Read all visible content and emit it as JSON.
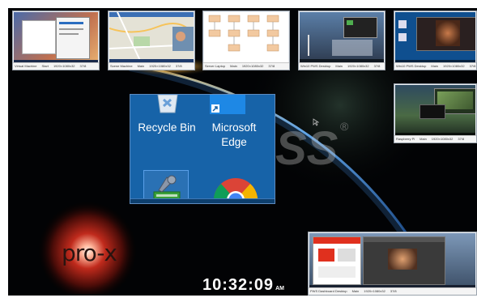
{
  "desktop": {
    "brand_text": "pro-x",
    "watermark_text": "SS",
    "registered_mark": "®",
    "clock": {
      "time": "10:32:09",
      "ampm": "AM"
    }
  },
  "desktop_icons": {
    "recycle_bin": {
      "label": "Recycle Bin",
      "icon": "recycle-bin-icon"
    },
    "edge": {
      "label_line1": "Microsoft",
      "label_line2": "Edge",
      "icon": "edge-icon"
    },
    "settings_tool": {
      "icon": "tools-icon"
    },
    "chrome": {
      "icon": "chrome-icon"
    }
  },
  "thumbnails": [
    {
      "name": "Virtual Machine",
      "status": "Start",
      "resolution": "1920×1080x32",
      "fps": "37/8"
    },
    {
      "name": "Scene Machine",
      "status": "Main",
      "resolution": "1920×1080x32",
      "fps": "37/8"
    },
    {
      "name": "Server Laptop",
      "status": "Main",
      "resolution": "1920×1080x32",
      "fps": "37/8"
    },
    {
      "name": "Win10 PWS Desktop",
      "status": "Main",
      "resolution": "1920×1080x32",
      "fps": "37/8"
    },
    {
      "name": "Win10 PWS Desktop",
      "status": "Main",
      "resolution": "1920×1080x32",
      "fps": "37/8"
    },
    {
      "name": "Raspberry Pi",
      "status": "Main",
      "resolution": "1920×1080x32",
      "fps": "37/8"
    },
    {
      "name": "PWS Dashboard Desktop",
      "status": "Main",
      "resolution": "1920×1080x32",
      "fps": "37/8"
    }
  ],
  "colors": {
    "desktop_blue": "#1763a8",
    "screen_bg": "#000000",
    "glow_red": "#b3201a"
  }
}
